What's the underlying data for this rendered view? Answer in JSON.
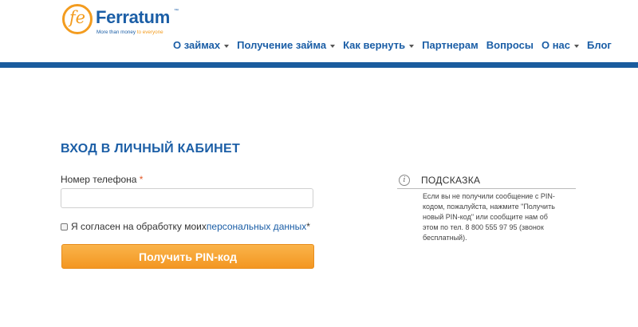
{
  "brand": {
    "logo_mark": "fe",
    "name": "Ferratum",
    "trademark": "™",
    "tagline_start": "More than money ",
    "tagline_highlight": "to everyone",
    "accent_color": "#f39c1f",
    "brand_color": "#1b5ea6"
  },
  "nav": {
    "items": [
      {
        "label": "О займах",
        "has_dropdown": true
      },
      {
        "label": "Получение займа",
        "has_dropdown": true
      },
      {
        "label": "Как вернуть",
        "has_dropdown": true
      },
      {
        "label": "Партнерам",
        "has_dropdown": false
      },
      {
        "label": "Вопросы",
        "has_dropdown": false
      },
      {
        "label": "О нас",
        "has_dropdown": true
      },
      {
        "label": "Блог",
        "has_dropdown": false
      }
    ]
  },
  "login": {
    "title": "ВХОД В ЛИЧНЫЙ КАБИНЕТ",
    "phone_label": "Номер телефона",
    "required_mark": "*",
    "phone_value": "",
    "consent_text": "Я согласен на обработку моих ",
    "consent_link": "персональных данных",
    "consent_required": "*",
    "consent_checked": false,
    "submit_label": "Получить PIN-код"
  },
  "hint": {
    "icon": "info-icon",
    "icon_glyph": "i",
    "title": "ПОДСКАЗКА",
    "text": "Если вы не получили сообщение с PIN-кодом, пожалуйста, нажмите \"Получить новый PIN-код\" или сообщите нам об этом по тел. 8 800 555 97 95 (звонок бесплатный)."
  }
}
